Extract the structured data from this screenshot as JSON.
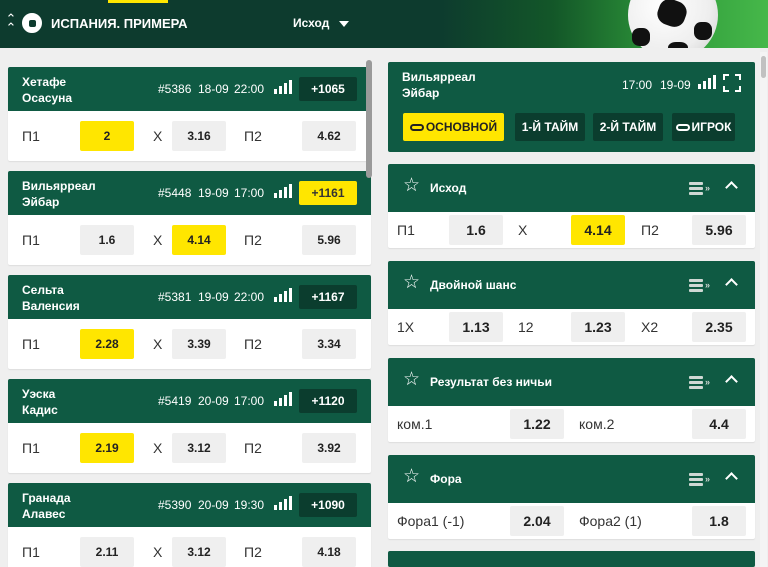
{
  "header": {
    "league_title": "ИСПАНИЯ. ПРИМЕРА",
    "market_dropdown": "Исход"
  },
  "matches": [
    {
      "home": "Хетафе",
      "away": "Осасуна",
      "id": "#5386",
      "date": "18-09",
      "time": "22:00",
      "count": "+1065",
      "count_highlight": false,
      "odds": {
        "p1_label": "П1",
        "p1": "2",
        "x_label": "X",
        "x": "3.16",
        "p2_label": "П2",
        "p2": "4.62"
      },
      "selected": "p1"
    },
    {
      "home": "Вильярреал",
      "away": "Эйбар",
      "id": "#5448",
      "date": "19-09",
      "time": "17:00",
      "count": "+1161",
      "count_highlight": true,
      "odds": {
        "p1_label": "П1",
        "p1": "1.6",
        "x_label": "X",
        "x": "4.14",
        "p2_label": "П2",
        "p2": "5.96"
      },
      "selected": "x"
    },
    {
      "home": "Сельта",
      "away": "Валенсия",
      "id": "#5381",
      "date": "19-09",
      "time": "22:00",
      "count": "+1167",
      "count_highlight": false,
      "odds": {
        "p1_label": "П1",
        "p1": "2.28",
        "x_label": "X",
        "x": "3.39",
        "p2_label": "П2",
        "p2": "3.34"
      },
      "selected": "p1"
    },
    {
      "home": "Уэска",
      "away": "Кадис",
      "id": "#5419",
      "date": "20-09",
      "time": "17:00",
      "count": "+1120",
      "count_highlight": false,
      "odds": {
        "p1_label": "П1",
        "p1": "2.19",
        "x_label": "X",
        "x": "3.12",
        "p2_label": "П2",
        "p2": "3.92"
      },
      "selected": "p1"
    },
    {
      "home": "Гранада",
      "away": "Алавес",
      "id": "#5390",
      "date": "20-09",
      "time": "19:30",
      "count": "+1090",
      "count_highlight": false,
      "odds": {
        "p1_label": "П1",
        "p1": "2.11",
        "x_label": "X",
        "x": "3.12",
        "p2_label": "П2",
        "p2": "4.18"
      },
      "selected": ""
    }
  ],
  "event": {
    "home": "Вильярреал",
    "away": "Эйбар",
    "time": "17:00",
    "date": "19-09",
    "tabs": [
      "ОСНОВНОЙ",
      "1-Й ТАЙМ",
      "2-Й ТАЙМ",
      "ИГРОК"
    ],
    "active_tab": 0
  },
  "markets": [
    {
      "title": "Исход",
      "outcomes": [
        {
          "label": "П1",
          "odd": "1.6"
        },
        {
          "label": "X",
          "odd": "4.14",
          "selected": true
        },
        {
          "label": "П2",
          "odd": "5.96"
        }
      ]
    },
    {
      "title": "Двойной шанс",
      "outcomes": [
        {
          "label": "1X",
          "odd": "1.13"
        },
        {
          "label": "12",
          "odd": "1.23"
        },
        {
          "label": "X2",
          "odd": "2.35"
        }
      ]
    },
    {
      "title": "Результат без ничьи",
      "outcomes": [
        {
          "label": "ком.1",
          "odd": "1.22"
        },
        {
          "label": "ком.2",
          "odd": "4.4"
        }
      ]
    },
    {
      "title": "Фора",
      "outcomes": [
        {
          "label": "Фора1 (-1)",
          "odd": "2.04"
        },
        {
          "label": "Фора2 (1)",
          "odd": "1.8"
        }
      ]
    }
  ],
  "colors": {
    "header_bg": "#0d3b2e",
    "panel_green": "#0f5a43",
    "dark_green": "#0b3d2e",
    "highlight_yellow": "#ffe600",
    "page_bg": "#efefef"
  },
  "icons": [
    "collapse-arrows-icon",
    "soccer-ball-icon",
    "chevron-down-icon",
    "stats-bars-icon",
    "fullscreen-icon",
    "star-icon",
    "coins-icon",
    "chevron-up-icon",
    "link-icon"
  ]
}
